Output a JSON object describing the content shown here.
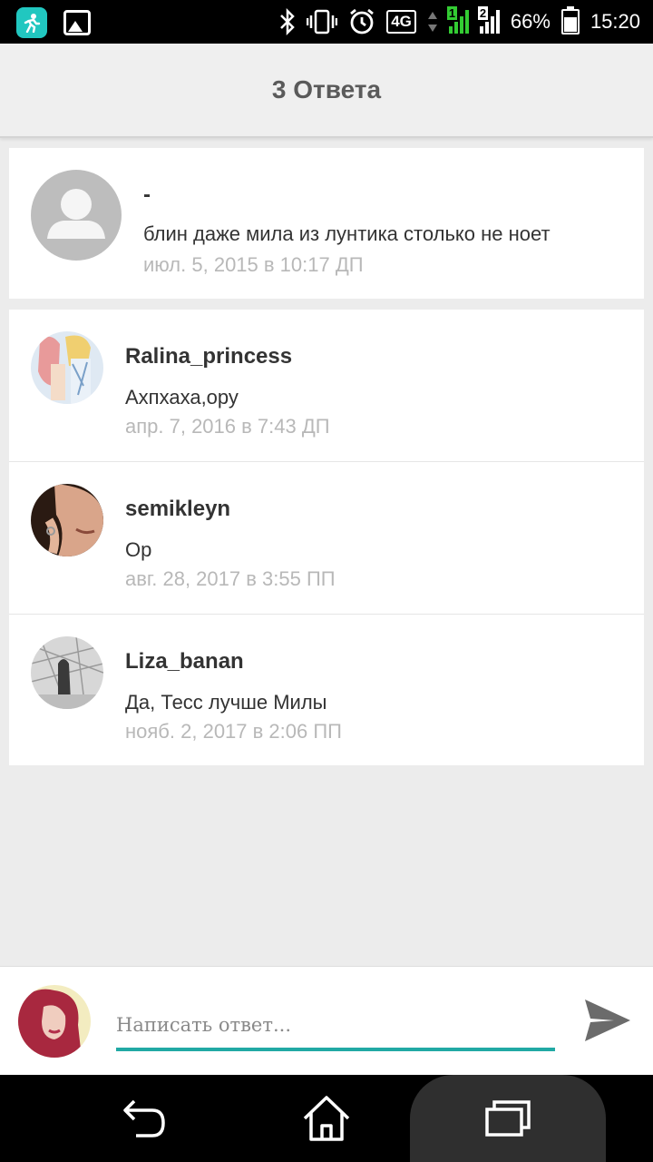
{
  "status_bar": {
    "battery": "66%",
    "time": "15:20",
    "network": "4G",
    "sim1": "1",
    "sim2": "2",
    "battery_level": 0.66
  },
  "header": {
    "title": "3 Ответа"
  },
  "original_comment": {
    "author": "-",
    "text": "блин даже мила из лунтика столько не ноет",
    "date": "июл. 5, 2015 в 10:17 ДП"
  },
  "replies": [
    {
      "author": "Ralina_princess",
      "text": "Ахпхаха,ору",
      "date": "апр. 7, 2016 в 7:43 ДП",
      "avatar_colors": [
        "#c9dcef",
        "#e8a8a8",
        "#f1d27a"
      ]
    },
    {
      "author": "semikleyn",
      "text": "Ор",
      "date": "авг. 28, 2017 в 3:55 ПП",
      "avatar_colors": [
        "#2a1a12",
        "#c98f6f",
        "#e3b59a"
      ]
    },
    {
      "author": "Liza_banan",
      "text": "Да, Тесс лучше Милы",
      "date": "нояб. 2, 2017 в 2:06 ПП",
      "avatar_colors": [
        "#d7d7d7",
        "#8a8a8a",
        "#333333"
      ]
    }
  ],
  "compose": {
    "placeholder": "Написать ответ...",
    "accent": "#21a9a4"
  },
  "colors": {
    "teal_accent": "#21a9a4",
    "date_gray": "#b8b8b8",
    "title_gray": "#5a5a5a"
  }
}
